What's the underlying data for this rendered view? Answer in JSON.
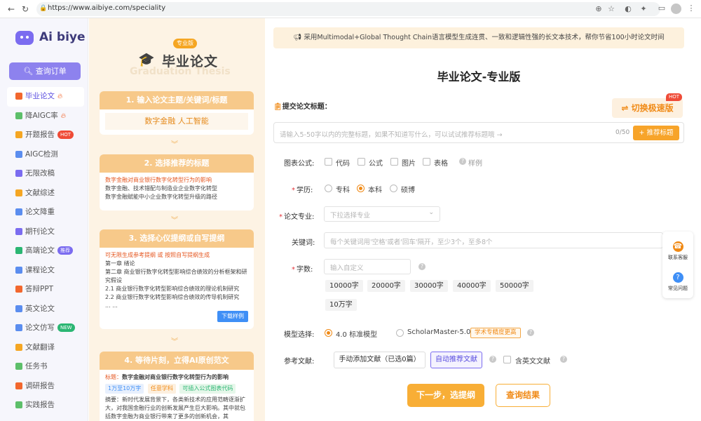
{
  "browser": {
    "url": "https://www.aibiye.com/speciality",
    "back_icon": "arrow-left",
    "refresh_icon": "refresh"
  },
  "sidebar": {
    "logo_text": "Ai biye",
    "order_button": "查询订单",
    "items": [
      {
        "label": "毕业论文",
        "badge": "fire",
        "color": "#f2672e",
        "active": true
      },
      {
        "label": "降AIGC率",
        "badge": "fire",
        "color": "#5dbf6a"
      },
      {
        "label": "开题报告",
        "badge": "HOT",
        "color": "#f5a623"
      },
      {
        "label": "AIGC检测",
        "badge": "",
        "color": "#5b8def"
      },
      {
        "label": "无限改稿",
        "badge": "",
        "color": "#7b6cf0"
      },
      {
        "label": "文献综述",
        "badge": "",
        "color": "#f5a623"
      },
      {
        "label": "论文降重",
        "badge": "",
        "color": "#5b8def"
      },
      {
        "label": "期刊论文",
        "badge": "",
        "color": "#7b6cf0"
      },
      {
        "label": "高端论文",
        "badge": "推荐",
        "color": "#2bb673"
      },
      {
        "label": "课程论文",
        "badge": "",
        "color": "#5b8def"
      },
      {
        "label": "答辩PPT",
        "badge": "",
        "color": "#f2672e"
      },
      {
        "label": "英文论文",
        "badge": "",
        "color": "#5b8def"
      },
      {
        "label": "论文仿写",
        "badge": "NEW",
        "color": "#5b8def"
      },
      {
        "label": "文献翻译",
        "badge": "",
        "color": "#f5a623"
      },
      {
        "label": "任务书",
        "badge": "",
        "color": "#5dbf6a"
      },
      {
        "label": "调研报告",
        "badge": "",
        "color": "#f2672e"
      },
      {
        "label": "实践报告",
        "badge": "",
        "color": "#5dbf6a"
      }
    ]
  },
  "promo": {
    "badge": "专业版",
    "title": "毕业论文",
    "subtitle": "Graduation Thesis",
    "step1": {
      "title": "1. 输入论文主题/关键词/标题",
      "content": "数字金融 人工智能"
    },
    "step2": {
      "title": "2. 选择推荐的标题",
      "lines": [
        "数字金融对商业银行数字化转型行为的影响",
        "数字金融、技术错配与制造业企业数字化转型",
        "数字金融赋能中小企业数字化转型升级的路径"
      ]
    },
    "step3": {
      "title": "3. 选择心仪提纲或自写提纲",
      "hint": "可无限生成参考提纲 或 按照自写提纲生成",
      "lines": [
        "第一章  绪论",
        "第二章  商业银行数字化转型影响综合绩效的分析框架和研究假设",
        "2.1 商业银行数字化转型影响综合绩效的理论机制研究",
        "2.2 商业银行数字化转型影响综合绩效的传导机制研究",
        "... ..."
      ],
      "download": "下载样例"
    },
    "step4": {
      "title": "4. 等待片刻，立得AI原创范文",
      "label": "标题：",
      "heading": "数字金融对商业银行数字化转型行为的影响",
      "tags": [
        "1万至10万字",
        "任意学科",
        "可插入公式图表代码"
      ],
      "abstract": "摘要：新时代发展背景下，各类新技术的应用范畴逐渐扩大，对我国金融行业的创新发展产生巨大影响。其中就包括数字金融为商业银行带来了更多的创新机会，其"
    }
  },
  "main": {
    "banner": "采用Multimodal+Global Thought Chain语言模型生成连贯、一致和逻辑性强的长文本技术，帮你节省100小时论文时间",
    "page_title": "毕业论文-专业版",
    "submit_title_label": "提交论文标题：",
    "switch_button": "切换极速版",
    "hot_badge": "HOT",
    "title_placeholder": "请输入5-50字以内的完整标题，如果不知道写什么，可以试试推荐标题哦 →",
    "title_counter": "0/50",
    "recommend_button": "+ 推荐标题",
    "chart_label": "图表公式:",
    "chart_options": [
      "代码",
      "公式",
      "图片",
      "表格"
    ],
    "sample_link": "样例",
    "degree_label": "学历:",
    "degree_options": [
      "专科",
      "本科",
      "硕博"
    ],
    "degree_selected": "本科",
    "major_label": "论文专业:",
    "major_placeholder": "下拉选择专业",
    "keywords_label": "关键词:",
    "keywords_placeholder": "每个关键词用'空格'或者'回车'隔开，至少3个，至多8个",
    "words_label": "字数:",
    "words_placeholder": "输入自定义",
    "word_chips": [
      "10000字",
      "20000字",
      "30000字",
      "40000字",
      "50000字",
      "10万字"
    ],
    "model_label": "模型选择:",
    "model_options": [
      "4.0 标准模型",
      "ScholarMaster-5.0"
    ],
    "model_selected": "4.0 标准模型",
    "model_tag": "学术专精度更高",
    "ref_label": "参考文献:",
    "ref_manual": "手动添加文献（已选0篇）",
    "ref_auto": "自动推荐文献",
    "ref_english": "含英文文献",
    "next_button": "下一步，选提纲",
    "query_button": "查询结果"
  },
  "float_panel": {
    "service": "联系客服",
    "faq": "常见问题"
  },
  "colors": {
    "accent": "#7b6cf0",
    "orange": "#f8ae36",
    "promo_bg": "#fdf3e4"
  }
}
